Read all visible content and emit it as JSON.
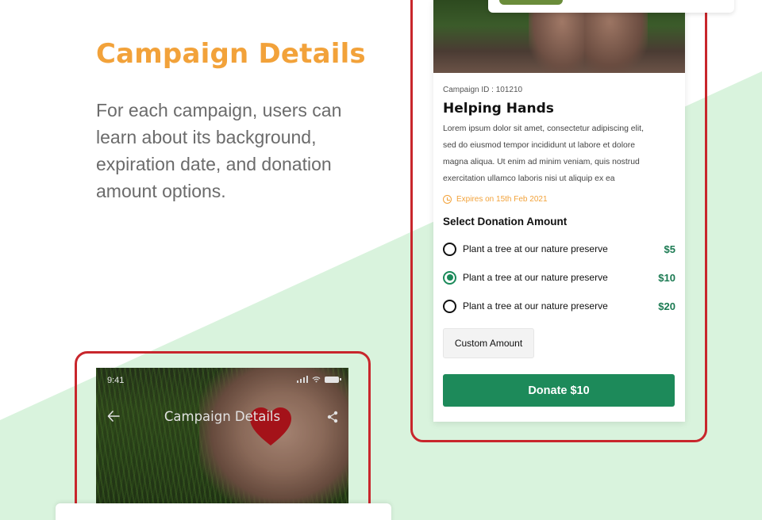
{
  "intro": {
    "heading": "Campaign Details",
    "description": "For each campaign, users can learn about its background, expiration date, and donation amount options."
  },
  "campaign": {
    "id_label": "Campaign ID : 101210",
    "title": "Helping Hands",
    "description_lines": [
      "Lorem ipsum dolor sit amet, consectetur adipiscing elit,",
      "sed do eiusmod tempor incididunt ut labore et dolore",
      "magna aliqua. Ut enim ad minim veniam, quis nostrud",
      "exercitation ullamco laboris nisi ut aliquip ex ea"
    ],
    "expires": "Expires on 15th Feb 2021",
    "select_label": "Select Donation Amount",
    "options": [
      {
        "label": "Plant a tree at our nature preserve",
        "amount": "$5",
        "selected": false
      },
      {
        "label": "Plant a tree at our nature preserve",
        "amount": "$10",
        "selected": true
      },
      {
        "label": "Plant a tree at our nature preserve",
        "amount": "$20",
        "selected": false
      }
    ],
    "custom_amount_label": "Custom Amount",
    "donate_label": "Donate $10"
  },
  "phone": {
    "time": "9:41",
    "nav_title": "Campaign Details",
    "icons": [
      "back-arrow-icon",
      "share-icon",
      "signal-icon",
      "wifi-icon",
      "battery-icon"
    ]
  },
  "colors": {
    "accent_orange": "#f2a23a",
    "primary_green": "#1d8a5a",
    "frame_red": "#c8262c",
    "mint_bg": "#d9f3dd"
  }
}
